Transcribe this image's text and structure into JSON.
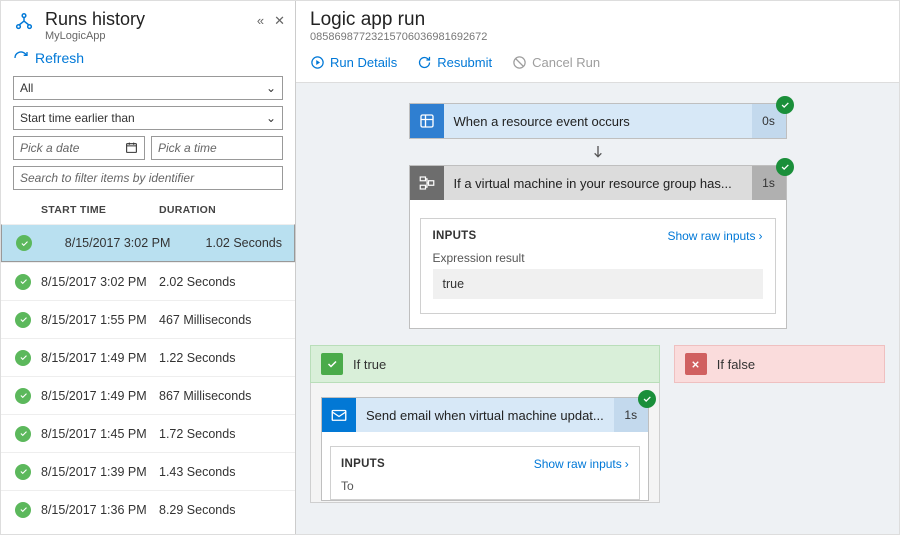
{
  "left": {
    "title": "Runs history",
    "subtitle": "MyLogicApp",
    "refresh": "Refresh",
    "filters": {
      "status": "All",
      "mode": "Start time earlier than",
      "date_placeholder": "Pick a date",
      "time_placeholder": "Pick a time",
      "search_placeholder": "Search to filter items by identifier"
    },
    "columns": {
      "start": "START TIME",
      "duration": "DURATION"
    },
    "rows": [
      {
        "start": "8/15/2017 3:02 PM",
        "duration": "1.02 Seconds",
        "selected": true
      },
      {
        "start": "8/15/2017 3:02 PM",
        "duration": "2.02 Seconds"
      },
      {
        "start": "8/15/2017 1:55 PM",
        "duration": "467 Milliseconds"
      },
      {
        "start": "8/15/2017 1:49 PM",
        "duration": "1.22 Seconds"
      },
      {
        "start": "8/15/2017 1:49 PM",
        "duration": "867 Milliseconds"
      },
      {
        "start": "8/15/2017 1:45 PM",
        "duration": "1.72 Seconds"
      },
      {
        "start": "8/15/2017 1:39 PM",
        "duration": "1.43 Seconds"
      },
      {
        "start": "8/15/2017 1:36 PM",
        "duration": "8.29 Seconds"
      }
    ]
  },
  "right": {
    "title": "Logic app run",
    "run_id": "08586987723215706036981692672",
    "toolbar": {
      "details": "Run Details",
      "resubmit": "Resubmit",
      "cancel": "Cancel Run"
    },
    "node1": {
      "label": "When a resource event occurs",
      "time": "0s"
    },
    "node2": {
      "label": "If a virtual machine in your resource group has...",
      "time": "1s",
      "inputs_title": "INPUTS",
      "show_raw": "Show raw inputs",
      "expr_label": "Expression result",
      "expr_value": "true"
    },
    "branch_true": {
      "label": "If true",
      "node": {
        "label": "Send email when virtual machine updat...",
        "time": "1s",
        "inputs_title": "INPUTS",
        "show_raw": "Show raw inputs",
        "to_label": "To"
      }
    },
    "branch_false": {
      "label": "If false"
    }
  }
}
